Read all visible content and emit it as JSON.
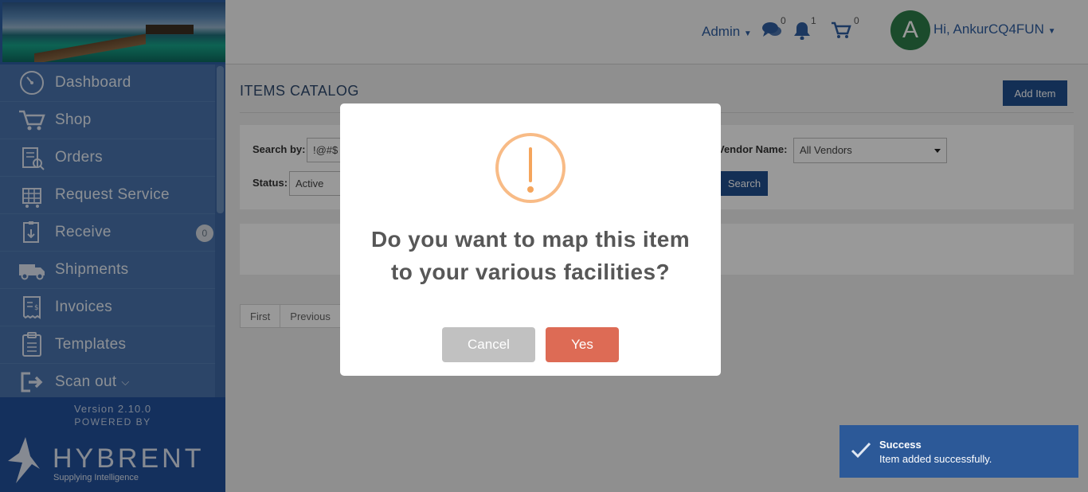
{
  "sidebar": {
    "items": [
      {
        "label": "Dashboard",
        "icon": "dashboard-icon"
      },
      {
        "label": "Shop",
        "icon": "cart-icon"
      },
      {
        "label": "Orders",
        "icon": "orders-icon"
      },
      {
        "label": "Request Service",
        "icon": "request-service-icon"
      },
      {
        "label": "Receive",
        "icon": "receive-icon",
        "badge": "0"
      },
      {
        "label": "Shipments",
        "icon": "truck-icon"
      },
      {
        "label": "Invoices",
        "icon": "invoice-icon"
      },
      {
        "label": "Templates",
        "icon": "templates-icon"
      },
      {
        "label": "Scan out",
        "icon": "scan-out-icon"
      }
    ],
    "version": "Version 2.10.0",
    "powered_by": "POWERED BY",
    "brand_name": "HYBRENT",
    "brand_tagline": "Supplying Intelligence"
  },
  "header": {
    "admin_label": "Admin",
    "messages_count": "0",
    "notifications_count": "1",
    "cart_count": "0",
    "avatar_letter": "A",
    "greeting": "Hi, AnkurCQ4FUN"
  },
  "main": {
    "title": "ITEMS CATALOG",
    "add_item_label": "Add Item",
    "search_by_label": "Search by:",
    "search_value": "!@#$",
    "status_label": "Status:",
    "status_value": "Active",
    "vendor_label": "Vendor Name:",
    "vendor_value": "All Vendors",
    "search_button": "Search",
    "pager": [
      "First",
      "Previous"
    ]
  },
  "modal": {
    "line1": "Do you want to map this item",
    "line2": "to your various facilities?",
    "cancel_label": "Cancel",
    "yes_label": "Yes"
  },
  "toast": {
    "title": "Success",
    "message": "Item added successfully."
  },
  "colors": {
    "sidebar": "#4a74ad",
    "primary": "#204f8e",
    "warning": "#f8bb86",
    "confirm": "#dd6b55"
  }
}
